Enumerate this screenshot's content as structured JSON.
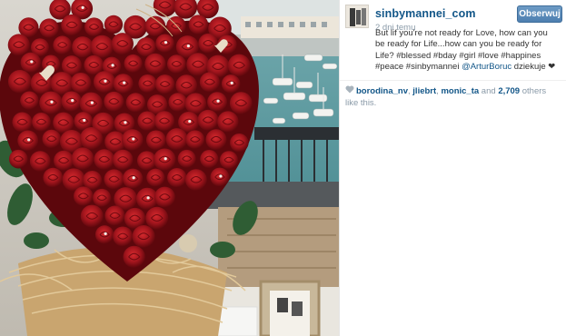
{
  "post": {
    "username": "sinbymannei_com",
    "follow_label": "Obserwuj",
    "time_ago": "2 dni temu",
    "caption_text": "But lif you're not ready for Love, how can you be ready for Life...how can you be ready for Life? #blessed #bday #girl #love #happines #peace #sinbymannei ",
    "caption_mention": "@ArturBoruc",
    "caption_end": " dziekuje ❤",
    "likes": {
      "heart_icon": "heart-icon",
      "users": [
        "borodina_nv",
        "jliebrt",
        "monic_ta"
      ],
      "sep1": ", ",
      "sep2": ", ",
      "and_text": " and ",
      "count": "2,709",
      "others_text": " others like this."
    }
  },
  "colors": {
    "username": "#125688",
    "follow_button": "#5a8ab9",
    "rose": "#a3151d"
  }
}
